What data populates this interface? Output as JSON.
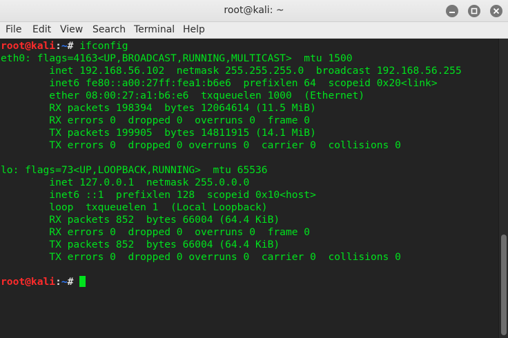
{
  "window": {
    "title": "root@kali: ~"
  },
  "menu": {
    "items": [
      "File",
      "Edit",
      "View",
      "Search",
      "Terminal",
      "Help"
    ]
  },
  "prompt": {
    "user": "root@kali",
    "sep": ":",
    "path": "~",
    "hash": "#"
  },
  "command": " ifconfig",
  "output": [
    "eth0: flags=4163<UP,BROADCAST,RUNNING,MULTICAST>  mtu 1500",
    "        inet 192.168.56.102  netmask 255.255.255.0  broadcast 192.168.56.255",
    "        inet6 fe80::a00:27ff:fea1:b6e6  prefixlen 64  scopeid 0x20<link>",
    "        ether 08:00:27:a1:b6:e6  txqueuelen 1000  (Ethernet)",
    "        RX packets 198394  bytes 12064614 (11.5 MiB)",
    "        RX errors 0  dropped 0  overruns 0  frame 0",
    "        TX packets 199905  bytes 14811915 (14.1 MiB)",
    "        TX errors 0  dropped 0 overruns 0  carrier 0  collisions 0",
    "",
    "lo: flags=73<UP,LOOPBACK,RUNNING>  mtu 65536",
    "        inet 127.0.0.1  netmask 255.0.0.0",
    "        inet6 ::1  prefixlen 128  scopeid 0x10<host>",
    "        loop  txqueuelen 1  (Local Loopback)",
    "        RX packets 852  bytes 66004 (64.4 KiB)",
    "        RX errors 0  dropped 0  overruns 0  frame 0",
    "        TX packets 852  bytes 66004 (64.4 KiB)",
    "        TX errors 0  dropped 0 overruns 0  carrier 0  collisions 0"
  ],
  "colors": {
    "output_text": "#00e21d",
    "prompt_user": "#ff2b2b",
    "prompt_path": "#2f7bff",
    "background": "#232323"
  }
}
